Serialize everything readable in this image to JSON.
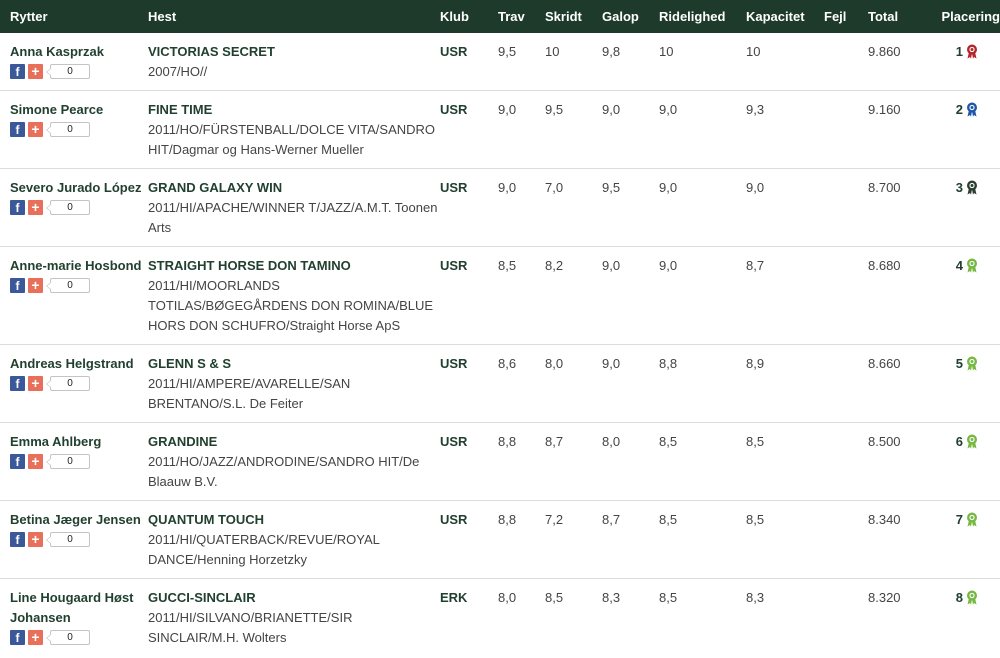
{
  "header": {
    "rider": "Rytter",
    "horse": "Hest",
    "club": "Klub",
    "trav": "Trav",
    "skridt": "Skridt",
    "galop": "Galop",
    "ridelighed": "Ridelighed",
    "kapacitet": "Kapacitet",
    "fejl": "Fejl",
    "total": "Total",
    "placering": "Placering"
  },
  "share": {
    "facebook_glyph": "f",
    "plus_glyph": "+"
  },
  "rows": [
    {
      "rider": "Anna Kasprzak",
      "horse": "VICTORIAS SECRET",
      "info": "2007/HO//",
      "club": "USR",
      "trav": "9,5",
      "skridt": "10",
      "galop": "9,8",
      "ridelighed": "10",
      "kapacitet": "10",
      "fejl": "",
      "total": "9.860",
      "place": "1",
      "count": "0",
      "rosette": "#b3262b"
    },
    {
      "rider": "Simone Pearce",
      "horse": "FINE TIME",
      "info": "2011/HO/FÜRSTENBALL/DOLCE VITA/SANDRO HIT/Dagmar og Hans-Werner Mueller",
      "club": "USR",
      "trav": "9,0",
      "skridt": "9,5",
      "galop": "9,0",
      "ridelighed": "9,0",
      "kapacitet": "9,3",
      "fejl": "",
      "total": "9.160",
      "place": "2",
      "count": "0",
      "rosette": "#1f56a8"
    },
    {
      "rider": "Severo Jurado López",
      "horse": "GRAND GALAXY WIN",
      "info": "2011/HI/APACHE/WINNER T/JAZZ/A.M.T. Toonen Arts",
      "club": "USR",
      "trav": "9,0",
      "skridt": "7,0",
      "galop": "9,5",
      "ridelighed": "9,0",
      "kapacitet": "9,0",
      "fejl": "",
      "total": "8.700",
      "place": "3",
      "count": "0",
      "rosette": "#2c3e2f"
    },
    {
      "rider": "Anne-marie Hosbond",
      "horse": "STRAIGHT HORSE DON TAMINO",
      "info": "2011/HI/MOORLANDS TOTILAS/BØGEGÅRDENS DON ROMINA/BLUE HORS DON SCHUFRO/Straight Horse ApS",
      "club": "USR",
      "trav": "8,5",
      "skridt": "8,2",
      "galop": "9,0",
      "ridelighed": "9,0",
      "kapacitet": "8,7",
      "fejl": "",
      "total": "8.680",
      "place": "4",
      "count": "0",
      "rosette": "#76b843"
    },
    {
      "rider": "Andreas Helgstrand",
      "horse": "GLENN S & S",
      "info": "2011/HI/AMPERE/AVARELLE/SAN BRENTANO/S.L. De Feiter",
      "club": "USR",
      "trav": "8,6",
      "skridt": "8,0",
      "galop": "9,0",
      "ridelighed": "8,8",
      "kapacitet": "8,9",
      "fejl": "",
      "total": "8.660",
      "place": "5",
      "count": "0",
      "rosette": "#76b843"
    },
    {
      "rider": "Emma Ahlberg",
      "horse": "GRANDINE",
      "info": "2011/HO/JAZZ/ANDRODINE/SANDRO HIT/De Blaauw B.V.",
      "club": "USR",
      "trav": "8,8",
      "skridt": "8,7",
      "galop": "8,0",
      "ridelighed": "8,5",
      "kapacitet": "8,5",
      "fejl": "",
      "total": "8.500",
      "place": "6",
      "count": "0",
      "rosette": "#76b843"
    },
    {
      "rider": "Betina Jæger Jensen",
      "horse": "QUANTUM TOUCH",
      "info": "2011/HI/QUATERBACK/REVUE/ROYAL DANCE/Henning Horzetzky",
      "club": "USR",
      "trav": "8,8",
      "skridt": "7,2",
      "galop": "8,7",
      "ridelighed": "8,5",
      "kapacitet": "8,5",
      "fejl": "",
      "total": "8.340",
      "place": "7",
      "count": "0",
      "rosette": "#76b843"
    },
    {
      "rider": "Line Hougaard Høst Johansen",
      "horse": "GUCCI-SINCLAIR",
      "info": "2011/HI/SILVANO/BRIANETTE/SIR SINCLAIR/M.H. Wolters",
      "club": "ERK",
      "trav": "8,0",
      "skridt": "8,5",
      "galop": "8,3",
      "ridelighed": "8,5",
      "kapacitet": "8,3",
      "fejl": "",
      "total": "8.320",
      "place": "8",
      "count": "0",
      "rosette": "#76b843"
    }
  ]
}
